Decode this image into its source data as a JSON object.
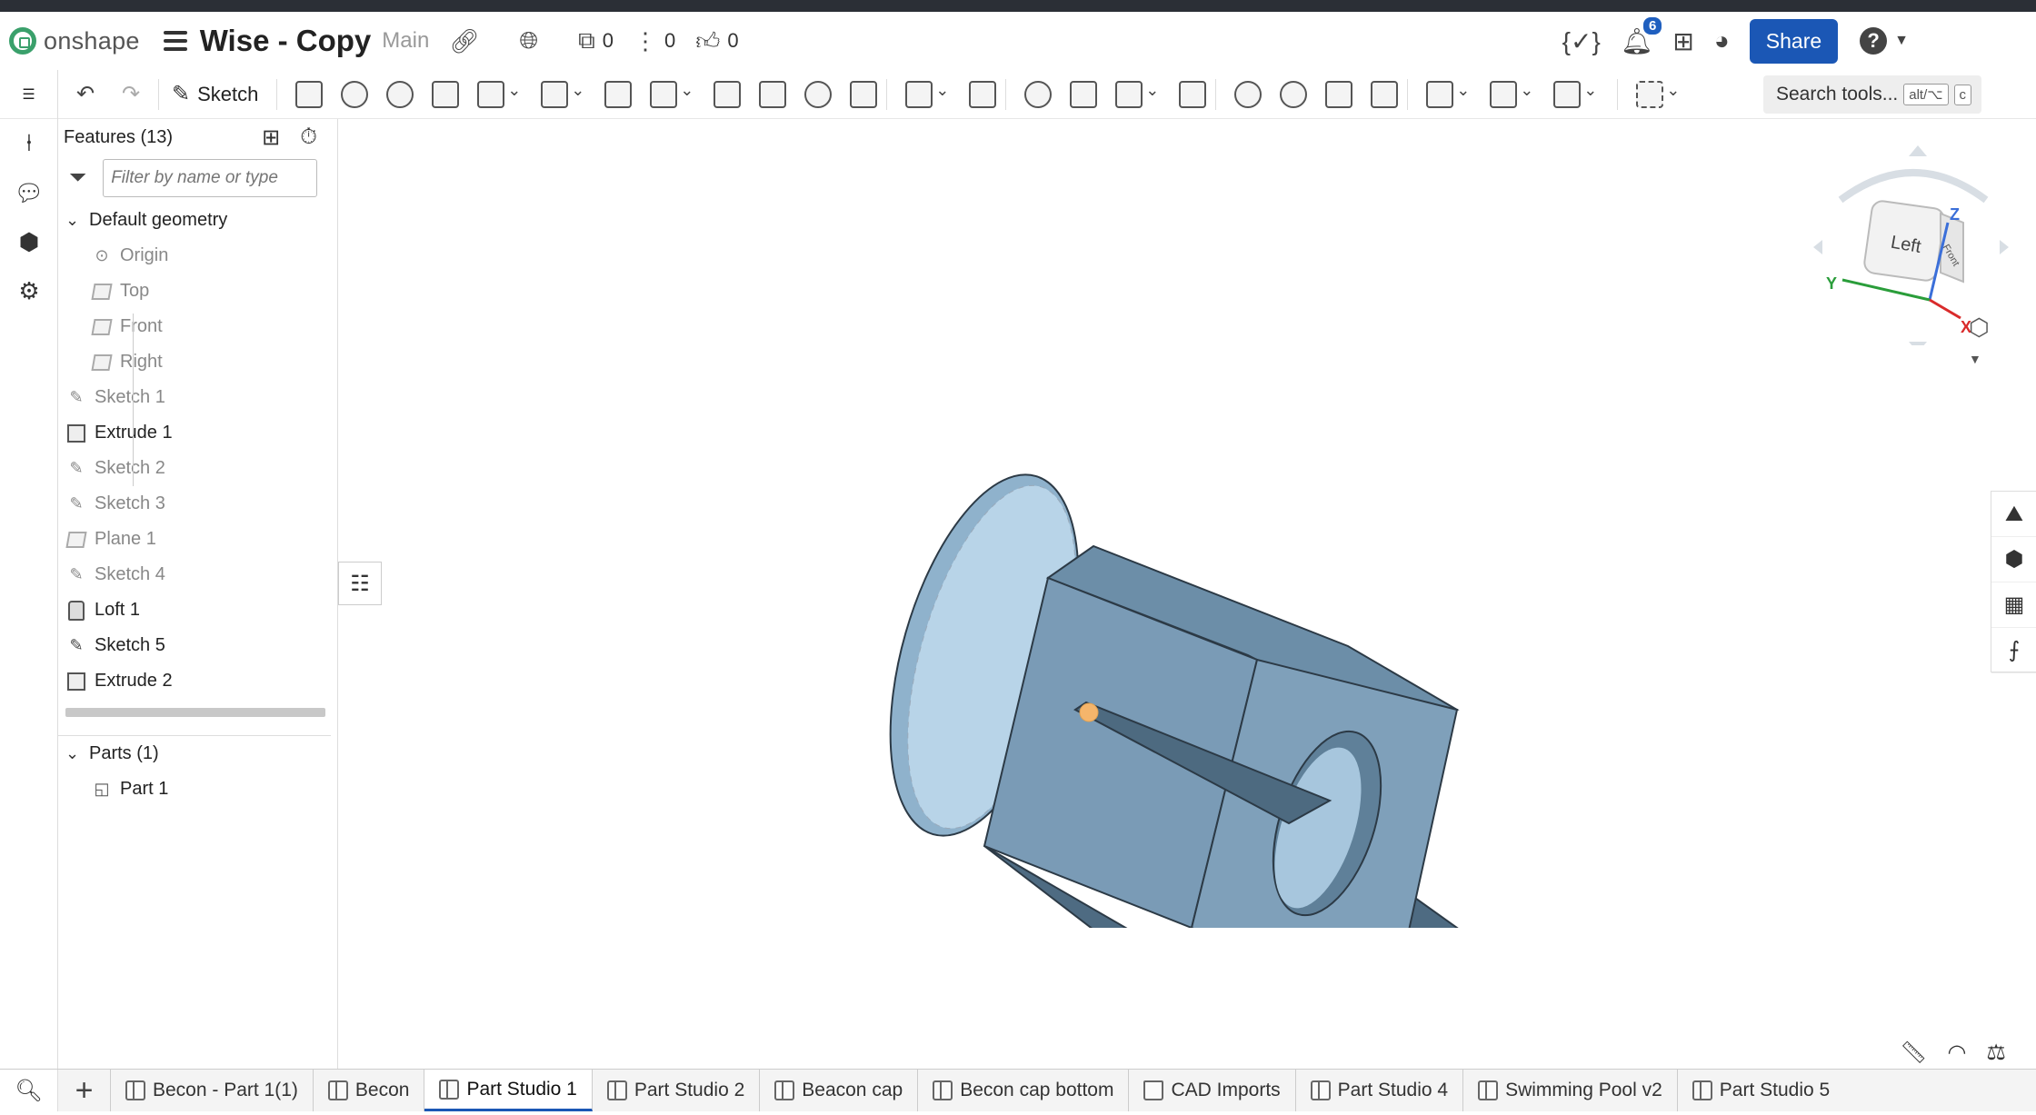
{
  "header": {
    "logo_text": "onshape",
    "doc_title": "Wise - Copy",
    "branch": "Main",
    "versions_count": "0",
    "branches_count": "0",
    "likes_count": "0",
    "notifications_count": "6",
    "share_label": "Share",
    "help_label": "?"
  },
  "toolbar": {
    "sketch_label": "Sketch",
    "search_label": "Search tools...",
    "search_kbd1": "alt/⌥",
    "search_kbd2": "c"
  },
  "features": {
    "title": "Features (13)",
    "filter_placeholder": "Filter by name or type",
    "default_geometry": "Default geometry",
    "items": [
      {
        "label": "Origin",
        "icon": "origin-icon",
        "dim": true
      },
      {
        "label": "Top",
        "icon": "plane-icon",
        "dim": true
      },
      {
        "label": "Front",
        "icon": "plane-icon",
        "dim": true
      },
      {
        "label": "Right",
        "icon": "plane-icon",
        "dim": true
      },
      {
        "label": "Sketch 1",
        "icon": "sketch-icon",
        "dim": true
      },
      {
        "label": "Extrude 1",
        "icon": "extrude-icon",
        "dim": false
      },
      {
        "label": "Sketch 2",
        "icon": "sketch-icon",
        "dim": true
      },
      {
        "label": "Sketch 3",
        "icon": "sketch-icon",
        "dim": true
      },
      {
        "label": "Plane 1",
        "icon": "plane-icon",
        "dim": true
      },
      {
        "label": "Sketch 4",
        "icon": "sketch-icon",
        "dim": true
      },
      {
        "label": "Loft 1",
        "icon": "loft-icon",
        "dim": false
      },
      {
        "label": "Sketch 5",
        "icon": "sketch-icon",
        "dim": false
      },
      {
        "label": "Extrude 2",
        "icon": "extrude-icon",
        "dim": false
      }
    ],
    "parts_title": "Parts (1)",
    "parts": [
      {
        "label": "Part 1"
      }
    ]
  },
  "viewcube": {
    "left_label": "Left",
    "front_label": "Front",
    "z": "Z",
    "y": "Y",
    "x": "X"
  },
  "tabs": [
    {
      "label": "Becon - Part 1(1)",
      "type": "part-studio",
      "active": false
    },
    {
      "label": "Becon",
      "type": "part-studio",
      "active": false
    },
    {
      "label": "Part Studio 1",
      "type": "part-studio",
      "active": true
    },
    {
      "label": "Part Studio 2",
      "type": "part-studio",
      "active": false
    },
    {
      "label": "Beacon cap",
      "type": "part-studio",
      "active": false
    },
    {
      "label": "Becon cap bottom",
      "type": "part-studio",
      "active": false
    },
    {
      "label": "CAD Imports",
      "type": "folder",
      "active": false
    },
    {
      "label": "Part Studio 4",
      "type": "part-studio",
      "active": false
    },
    {
      "label": "Swimming Pool v2",
      "type": "part-studio",
      "active": false
    },
    {
      "label": "Part Studio 5",
      "type": "part-studio",
      "active": false
    }
  ],
  "colors": {
    "brand_green": "#3aa06b",
    "share_blue": "#1b57b5",
    "model_face": "#7a9bb6",
    "model_face_dark": "#5f8099",
    "model_edge": "#2c3a46",
    "selection_point": "#f5b56b"
  }
}
